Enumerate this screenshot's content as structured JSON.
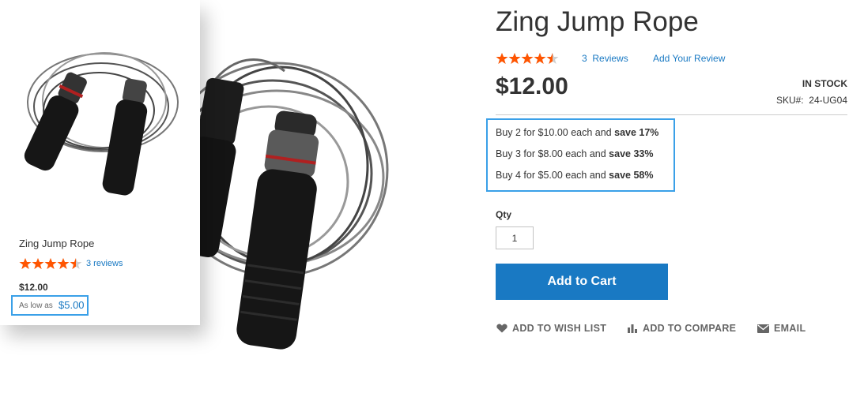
{
  "card": {
    "name": "Zing Jump Rope",
    "rating_percent": 90,
    "reviews_link": "3 reviews",
    "price": "$12.00",
    "as_low_as_label": "As low as",
    "as_low_as_value": "$5.00"
  },
  "product": {
    "title": "Zing Jump Rope",
    "rating_percent": 90,
    "reviews_count": "3",
    "reviews_label": "Reviews",
    "add_review": "Add Your Review",
    "price": "$12.00",
    "stock": "IN STOCK",
    "sku_label": "SKU#:",
    "sku_value": "24-UG04",
    "tier_prices": [
      {
        "text": "Buy 2 for $10.00 each and ",
        "save": "save 17%"
      },
      {
        "text": "Buy 3 for $8.00 each and ",
        "save": "save 33%"
      },
      {
        "text": "Buy 4 for $5.00 each and ",
        "save": "save 58%"
      }
    ],
    "qty_label": "Qty",
    "qty_value": "1",
    "add_to_cart": "Add to Cart",
    "actions": {
      "wishlist": "ADD TO WISH LIST",
      "compare": "ADD TO COMPARE",
      "email": "EMAIL"
    }
  },
  "colors": {
    "accent": "#1979c3",
    "star": "#ff5501",
    "highlight_border": "#3aa0e8"
  },
  "icons": {
    "rating": "star-icon",
    "wishlist": "heart-icon",
    "compare": "bar-chart-icon",
    "email": "envelope-icon"
  }
}
